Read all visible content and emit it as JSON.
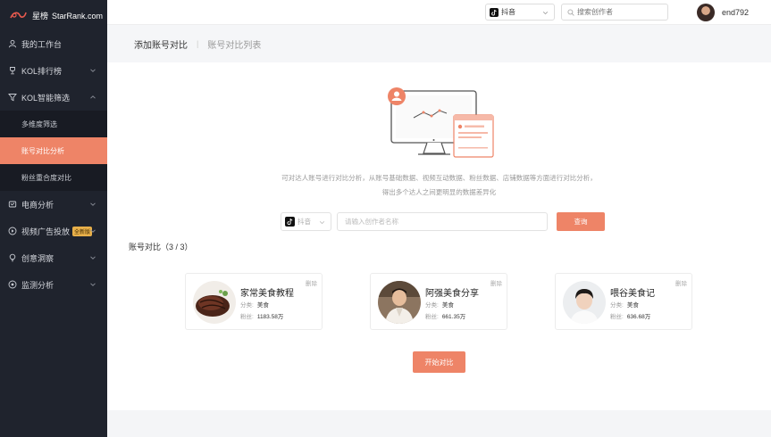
{
  "brand": {
    "name_cn": "星榜",
    "name_en": "StarRank.com"
  },
  "sidebar": {
    "items": [
      {
        "label": "我的工作台"
      },
      {
        "label": "KOL排行榜"
      },
      {
        "label": "KOL智能筛选"
      },
      {
        "label": "多维度筛选"
      },
      {
        "label": "账号对比分析"
      },
      {
        "label": "粉丝重合度对比"
      },
      {
        "label": "电商分析"
      },
      {
        "label": "视频广告投放",
        "badge": "全新版"
      },
      {
        "label": "创意洞察"
      },
      {
        "label": "监测分析"
      }
    ],
    "active_item": "账号对比分析"
  },
  "topbar": {
    "platform": "抖音",
    "search_placeholder": "搜索创作者",
    "username": "end792"
  },
  "tabs": [
    {
      "label": "添加账号对比",
      "active": true
    },
    {
      "label": "账号对比列表",
      "active": false
    }
  ],
  "tab_separator": "|",
  "description": {
    "line1": "可对达人账号进行对比分析，从账号基础数据、视频互动数据、粉丝数据、店铺数据等方面进行对比分析，",
    "line2": "得出多个达人之间更明显的数据差异化"
  },
  "search": {
    "platform": "抖音",
    "placeholder": "请输入创作者名称",
    "button": "查询"
  },
  "count_label": "账号对比（3 / 3）",
  "cards": [
    {
      "name": "家常美食教程",
      "category_label": "分类:",
      "category": "美食",
      "fans_label": "粉丝:",
      "fans": "1183.58万",
      "delete": "删除"
    },
    {
      "name": "阿强美食分享",
      "category_label": "分类:",
      "category": "美食",
      "fans_label": "粉丝:",
      "fans": "661.35万",
      "delete": "删除"
    },
    {
      "name": "喂谷美食记",
      "category_label": "分类:",
      "category": "美食",
      "fans_label": "粉丝:",
      "fans": "636.68万",
      "delete": "删除"
    }
  ],
  "start_button": "开始对比",
  "colors": {
    "accent": "#ee8467",
    "sidebar_bg": "#1f232d"
  }
}
